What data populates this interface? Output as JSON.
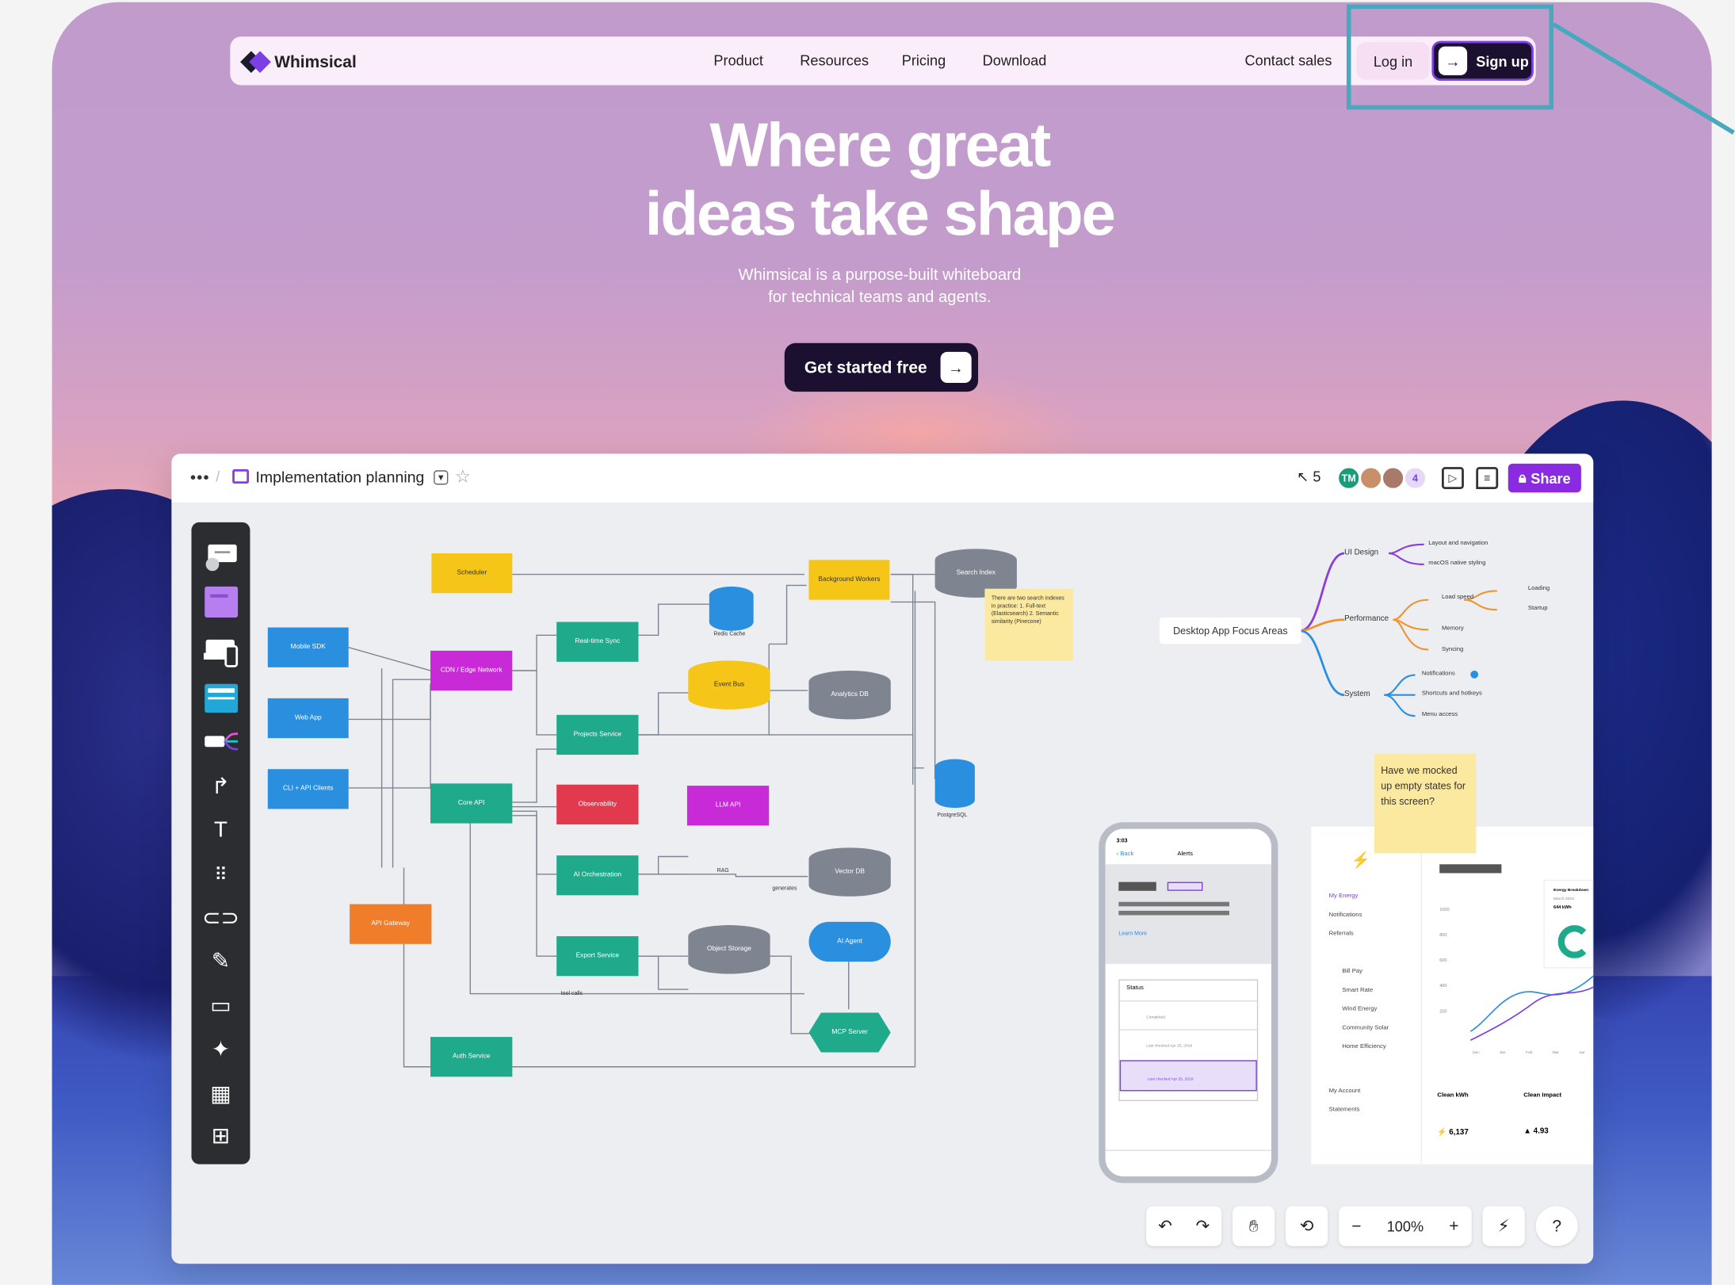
{
  "nav": {
    "brand": "Whimsical",
    "links": [
      "Product",
      "Resources",
      "Pricing",
      "Download"
    ],
    "contact_sales": "Contact sales",
    "login": "Log in",
    "signup": "Sign up"
  },
  "hero": {
    "title_line1": "Where great",
    "title_line2": "ideas take shape",
    "subtitle_line1": "Whimsical is a purpose-built whiteboard",
    "subtitle_line2": "for technical teams and agents.",
    "cta": "Get started free"
  },
  "app": {
    "more": "•••",
    "breadcrumb_sep": "/",
    "doc_title": "Implementation planning",
    "cursor_count": "5",
    "avatar_initials": "TM",
    "avatar_extra": "4",
    "share": "Share",
    "zoom": "100%",
    "help": "?"
  },
  "diagram": {
    "nodes": {
      "scheduler": "Scheduler",
      "background_workers": "Background Workers",
      "search_index": "Search Index",
      "mobile_sdk": "Mobile SDK",
      "cdn": "CDN / Edge Network",
      "realtime_sync": "Real-time Sync",
      "redis_cache": "Redis Cache",
      "web_app": "Web App",
      "event_bus": "Event Bus",
      "analytics_db": "Analytics DB",
      "projects_service": "Projects Service",
      "cli": "CLI + API Clients",
      "core_api": "Core API",
      "observability": "Observability",
      "llm_api": "LLM API",
      "postgresql": "PostgreSQL",
      "ai_orchestration": "AI Orchestration",
      "vector_db": "Vector DB",
      "rag": "RAG",
      "generates": "generates",
      "api_gateway": "API Gateway",
      "export_service": "Export Service",
      "object_storage": "Object Storage",
      "ai_agent": "AI Agent",
      "tool_calls": "tool calls",
      "mcp_server": "MCP Server",
      "auth_service": "Auth Service"
    },
    "search_note": "There are two search indexes in practice: 1. Full-text (Elasticsearch) 2. Semantic similarity (Pinecone)"
  },
  "mindmap": {
    "root": "Desktop App Focus Areas",
    "branches": [
      {
        "label": "UI Design",
        "children": [
          "Layout and navigation",
          "macOS native styling"
        ]
      },
      {
        "label": "Performance",
        "children": [
          "Load speed",
          "Memory",
          "Syncing"
        ],
        "grandchildren": [
          "Loading",
          "Startup"
        ]
      },
      {
        "label": "System",
        "children": [
          "Notifications",
          "Shortcuts and hotkeys",
          "Menu access"
        ]
      }
    ]
  },
  "sticky_note": "Have we mocked up empty states for this screen?",
  "phone": {
    "time": "3:03",
    "back": "Back",
    "title": "Alerts",
    "learn_more": "Learn More",
    "status": "Status",
    "item_sub1": "Completed",
    "item_sub2": "Last checked Apr 25, 2019",
    "item_sub3": "Last checked Apr 25, 2019"
  },
  "dashboard": {
    "menu": [
      "My Energy",
      "Notifications",
      "Referrals",
      "Bill Pay",
      "Smart Rate",
      "Wind Energy",
      "Community Solar",
      "Home Efficiency",
      "My Account",
      "Statements"
    ],
    "y_ticks": [
      "1000",
      "800",
      "600",
      "400",
      "200"
    ],
    "x_ticks": [
      "Dec",
      "Jan",
      "Feb",
      "Mar",
      "Apr"
    ],
    "energy_title": "Energy Breakdown",
    "energy_date": "March 2024",
    "energy_value": "644 kWh",
    "clean_kwh_label": "Clean kWh",
    "clean_kwh_value": "6,137",
    "clean_impact_label": "Clean Impact",
    "clean_impact_value": "4.93"
  },
  "colors": {
    "accent": "#8a2be2",
    "dark": "#1b1030",
    "highlight": "#48a8bc"
  }
}
